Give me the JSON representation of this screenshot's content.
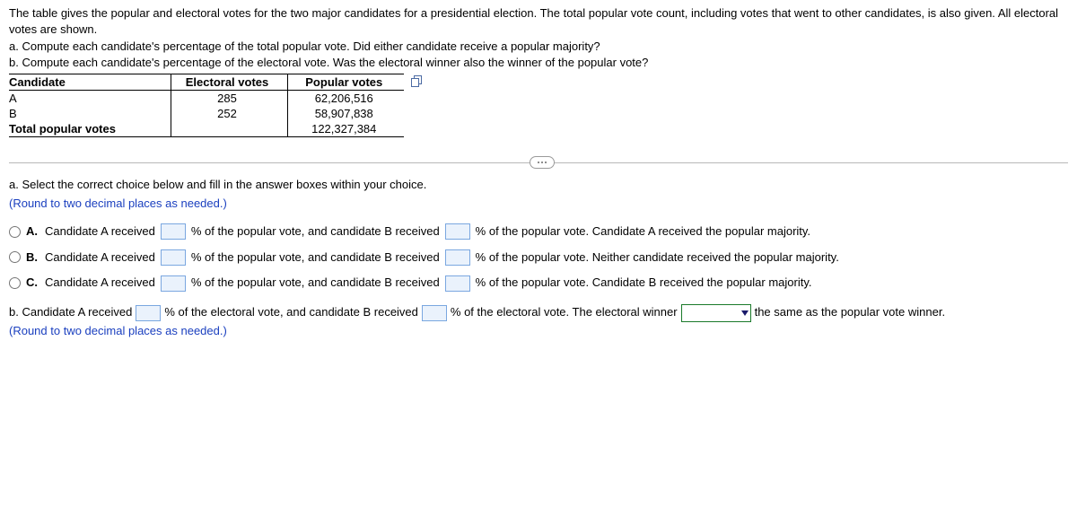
{
  "intro": {
    "p1": "The table gives the popular and electoral votes for the two major candidates for a presidential election. The total popular vote count, including votes that went to other candidates, is also given. All electoral votes are shown.",
    "qa": "a. Compute each candidate's percentage of the total popular vote. Did either candidate receive a popular majority?",
    "qb": "b. Compute each candidate's percentage of the electoral vote. Was the electoral winner also the winner of the popular vote?"
  },
  "table": {
    "headers": {
      "c1": "Candidate",
      "c2": "Electoral votes",
      "c3": "Popular votes"
    },
    "rows": [
      {
        "c1": "A",
        "c2": "285",
        "c3": "62,206,516"
      },
      {
        "c1": "B",
        "c2": "252",
        "c3": "58,907,838"
      },
      {
        "c1": "Total popular votes",
        "c2": "",
        "c3": "122,327,384"
      }
    ]
  },
  "partA": {
    "prompt": "a. Select the correct choice below and fill in the answer boxes within your choice.",
    "hint": "(Round to two decimal places as needed.)",
    "labels": {
      "A": "A.",
      "B": "B.",
      "C": "C."
    },
    "seg": {
      "s1": "Candidate A received",
      "s2": "% of the popular vote, and candidate B received",
      "endA": "% of the popular vote. Candidate A received the popular majority.",
      "endB": "% of the popular vote. Neither candidate received the popular majority.",
      "endC": "% of the popular vote. Candidate B received the popular majority."
    }
  },
  "partB": {
    "s1": "b. Candidate A received",
    "s2": "% of the electoral vote, and candidate B received",
    "s3": "% of the electoral vote. The electoral winner",
    "s4": "the same as the popular vote winner.",
    "hint": "(Round to two decimal places as needed.)"
  }
}
